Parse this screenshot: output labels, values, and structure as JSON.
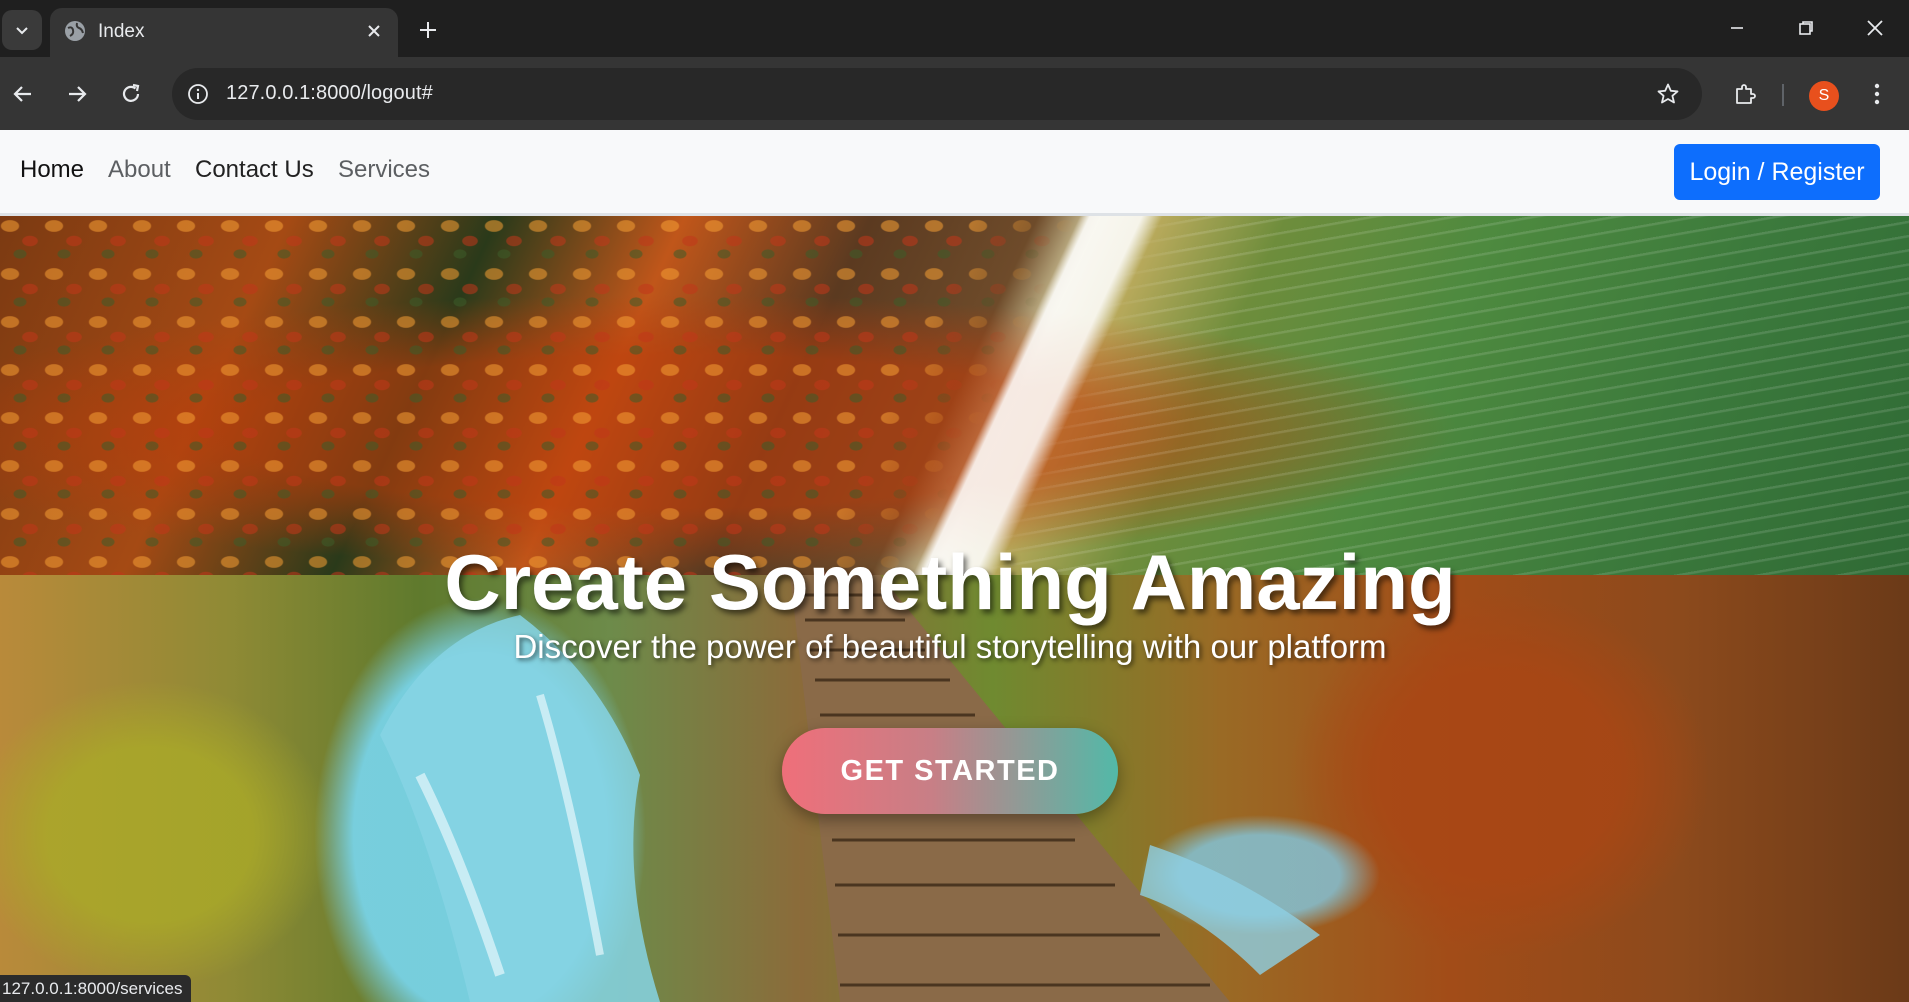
{
  "browser": {
    "tab": {
      "title": "Index",
      "favicon": "globe-icon"
    },
    "url": "127.0.0.1:8000/logout#",
    "profile_initial": "S",
    "profile_color": "#e8501d",
    "status_url": "127.0.0.1:8000/services"
  },
  "navbar": {
    "links": [
      {
        "label": "Home"
      },
      {
        "label": "About"
      },
      {
        "label": "Contact Us"
      },
      {
        "label": "Services"
      }
    ],
    "login_label": "Login / Register",
    "login_color": "#0d6efd"
  },
  "hero": {
    "title": "Create Something Amazing",
    "subtitle": "Discover the power of beautiful storytelling with our platform",
    "cta_label": "GET STARTED",
    "cta_gradient": [
      "#ef6f7a",
      "#52b9a8"
    ]
  }
}
